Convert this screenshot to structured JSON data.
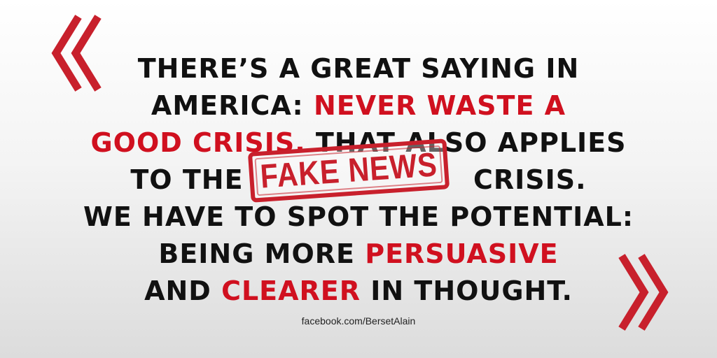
{
  "quote": {
    "line1": "THERE’S A GREAT SAYING IN",
    "line2_a": "AMERICA: ",
    "line2_b": "NEVER WASTE A",
    "line3_a": "GOOD CRISIS.",
    "line3_b": " THAT ALSO APPLIES",
    "line4_a": "TO THE ",
    "line4_b": " CRISIS.",
    "line5": "WE HAVE TO SPOT THE POTENTIAL:",
    "line6_a": "BEING MORE ",
    "line6_b": "PERSUASIVE",
    "line7_a": "AND ",
    "line7_b": "CLEARER",
    "line7_c": " IN THOUGHT."
  },
  "stamp": {
    "text": "FAKE NEWS"
  },
  "source": "facebook.com/BersetAlain",
  "icons": {
    "open": "open-quote-chevrons-icon",
    "close": "close-quote-chevrons-icon"
  },
  "colors": {
    "accent": "#d0101f",
    "text": "#111111",
    "stamp": "#c8202c"
  }
}
